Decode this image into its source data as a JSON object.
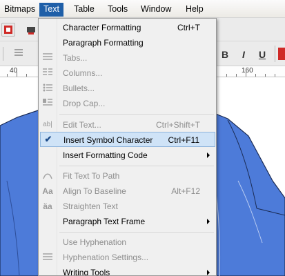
{
  "menubar": {
    "items": [
      {
        "label": "Bitmaps",
        "active": false
      },
      {
        "label": "Text",
        "active": true
      },
      {
        "label": "Table",
        "active": false
      },
      {
        "label": "Tools",
        "active": false
      },
      {
        "label": "Window",
        "active": false
      },
      {
        "label": "Help",
        "active": false
      }
    ]
  },
  "ruler": {
    "labels": [
      "40",
      "160"
    ]
  },
  "format_buttons": [
    "B",
    "I",
    "U"
  ],
  "text_menu": {
    "items": [
      {
        "label": "Character Formatting",
        "shortcut": "Ctrl+T",
        "enabled": true,
        "icon": ""
      },
      {
        "label": "Paragraph Formatting",
        "shortcut": "",
        "enabled": true,
        "icon": ""
      },
      {
        "label": "Tabs...",
        "shortcut": "",
        "enabled": false,
        "icon": "tabs-icon"
      },
      {
        "label": "Columns...",
        "shortcut": "",
        "enabled": false,
        "icon": "columns-icon"
      },
      {
        "label": "Bullets...",
        "shortcut": "",
        "enabled": false,
        "icon": "bullets-icon"
      },
      {
        "label": "Drop Cap...",
        "shortcut": "",
        "enabled": false,
        "icon": "drop-cap-icon"
      },
      {
        "label": "Edit Text...",
        "shortcut": "Ctrl+Shift+T",
        "enabled": false,
        "icon": "edit-text-icon"
      },
      {
        "label": "Insert Symbol Character",
        "shortcut": "Ctrl+F11",
        "enabled": true,
        "checked": true
      },
      {
        "label": "Insert Formatting Code",
        "shortcut": "",
        "enabled": true,
        "submenu": true
      },
      {
        "label": "Fit Text To Path",
        "shortcut": "",
        "enabled": false,
        "icon": "fit-text-to-path-icon"
      },
      {
        "label": "Align To Baseline",
        "shortcut": "Alt+F12",
        "enabled": false,
        "icon": "align-baseline-icon"
      },
      {
        "label": "Straighten Text",
        "shortcut": "",
        "enabled": false,
        "icon": "straighten-text-icon"
      },
      {
        "label": "Paragraph Text Frame",
        "shortcut": "",
        "enabled": true,
        "submenu": true
      },
      {
        "label": "Use Hyphenation",
        "shortcut": "",
        "enabled": false
      },
      {
        "label": "Hyphenation Settings...",
        "shortcut": "",
        "enabled": false,
        "icon": "hyphenation-settings-icon"
      },
      {
        "label": "Writing Tools",
        "shortcut": "",
        "enabled": true,
        "submenu": true
      }
    ]
  },
  "colors": {
    "menu_highlight": "#1f5fa8",
    "shirt_blue": "#4d7bd9"
  }
}
